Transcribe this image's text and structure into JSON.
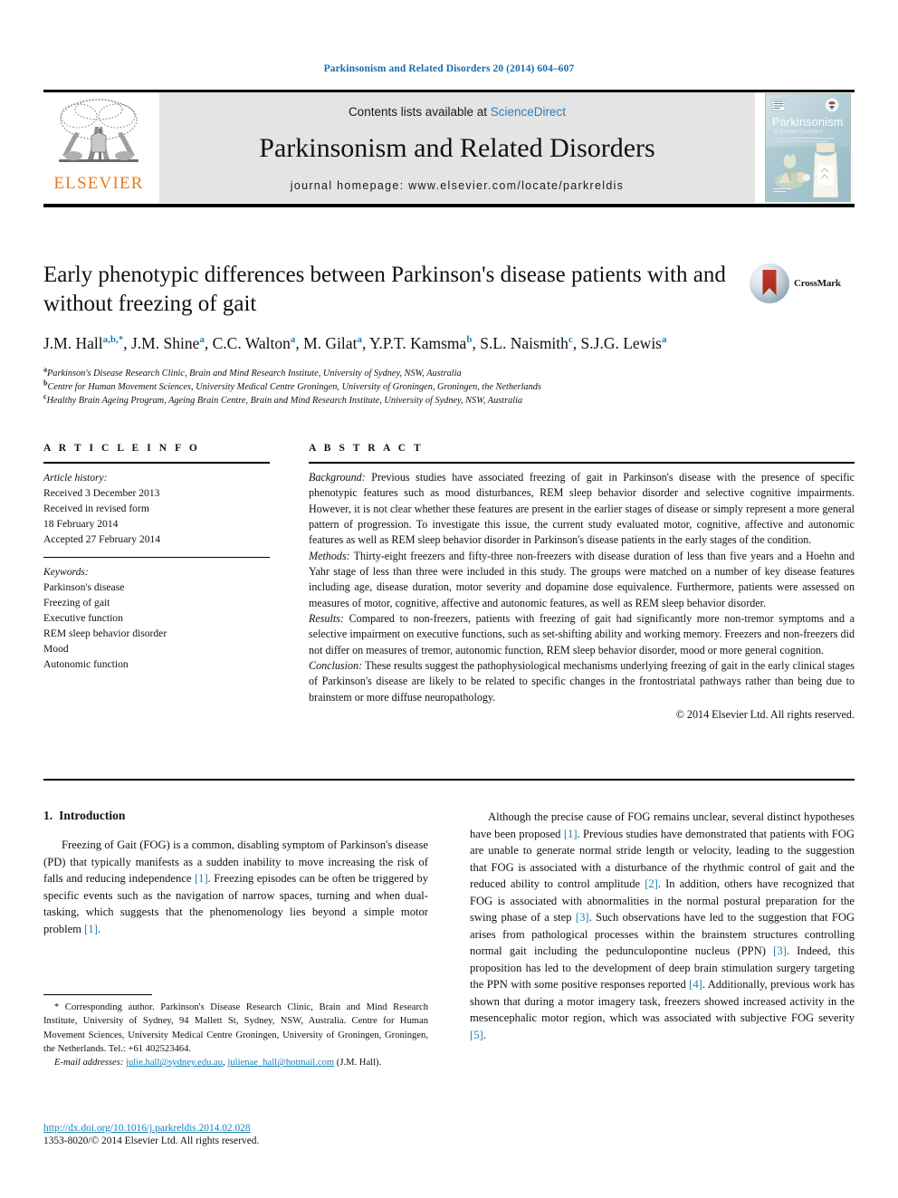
{
  "running_head": "Parkinsonism and Related Disorders 20 (2014) 604–607",
  "masthead": {
    "publisher_wordmark": "ELSEVIER",
    "contents_prefix": "Contents lists available at ",
    "contents_link": "ScienceDirect",
    "journal_title": "Parkinsonism and Related Disorders",
    "homepage": "journal homepage: www.elsevier.com/locate/parkreldis",
    "cover_title": "Parkinsonism",
    "cover_subtitle": "& Related Disorders"
  },
  "article": {
    "title": "Early phenotypic differences between Parkinson's disease patients with and without freezing of gait",
    "crossmark_label": "CrossMark",
    "authors_html": "J.M. Hall<sup>a,b,*</sup>, J.M. Shine<sup>a</sup>, C.C. Walton<sup>a</sup>, M. Gilat<sup>a</sup>, Y.P.T. Kamsma<sup>b</sup>, S.L. Naismith<sup>c</sup>, S.J.G. Lewis<sup>a</sup>",
    "affiliations": [
      {
        "marker": "a",
        "text": "Parkinson's Disease Research Clinic, Brain and Mind Research Institute, University of Sydney, NSW, Australia"
      },
      {
        "marker": "b",
        "text": "Centre for Human Movement Sciences, University Medical Centre Groningen, University of Groningen, Groningen, the Netherlands"
      },
      {
        "marker": "c",
        "text": "Healthy Brain Ageing Program, Ageing Brain Centre, Brain and Mind Research Institute, University of Sydney, NSW, Australia"
      }
    ]
  },
  "article_info": {
    "heading": "A R T I C L E  I N F O",
    "history_label": "Article history:",
    "history_lines": [
      "Received 3 December 2013",
      "Received in revised form",
      "18 February 2014",
      "Accepted 27 February 2014"
    ],
    "keywords_label": "Keywords:",
    "keywords": [
      "Parkinson's disease",
      "Freezing of gait",
      "Executive function",
      "REM sleep behavior disorder",
      "Mood",
      "Autonomic function"
    ]
  },
  "abstract": {
    "heading": "A B S T R A C T",
    "background_label": "Background:",
    "background_text": " Previous studies have associated freezing of gait in Parkinson's disease with the presence of specific phenotypic features such as mood disturbances, REM sleep behavior disorder and selective cognitive impairments. However, it is not clear whether these features are present in the earlier stages of disease or simply represent a more general pattern of progression. To investigate this issue, the current study evaluated motor, cognitive, affective and autonomic features as well as REM sleep behavior disorder in Parkinson's disease patients in the early stages of the condition.",
    "methods_label": "Methods:",
    "methods_text": " Thirty-eight freezers and fifty-three non-freezers with disease duration of less than five years and a Hoehn and Yahr stage of less than three were included in this study. The groups were matched on a number of key disease features including age, disease duration, motor severity and dopamine dose equivalence. Furthermore, patients were assessed on measures of motor, cognitive, affective and autonomic features, as well as REM sleep behavior disorder.",
    "results_label": "Results:",
    "results_text": " Compared to non-freezers, patients with freezing of gait had significantly more non-tremor symptoms and a selective impairment on executive functions, such as set-shifting ability and working memory. Freezers and non-freezers did not differ on measures of tremor, autonomic function, REM sleep behavior disorder, mood or more general cognition.",
    "conclusion_label": "Conclusion:",
    "conclusion_text": " These results suggest the pathophysiological mechanisms underlying freezing of gait in the early clinical stages of Parkinson's disease are likely to be related to specific changes in the frontostriatal pathways rather than being due to brainstem or more diffuse neuropathology.",
    "copyright": "© 2014 Elsevier Ltd. All rights reserved."
  },
  "introduction": {
    "number": "1.",
    "heading": "Introduction",
    "left_paragraph_html": "Freezing of Gait (FOG) is a common, disabling symptom of Parkinson's disease (PD) that typically manifests as a sudden inability to move increasing the risk of falls and reducing independence <span class=\"ref\">[1]</span>. Freezing episodes can be often be triggered by specific events such as the navigation of narrow spaces, turning and when dual-tasking, which suggests that the phenomenology lies beyond a simple motor problem <span class=\"ref\">[1]</span>.",
    "right_paragraph_html": "Although the precise cause of FOG remains unclear, several distinct hypotheses have been proposed <span class=\"ref\">[1]</span>. Previous studies have demonstrated that patients with FOG are unable to generate normal stride length or velocity, leading to the suggestion that FOG is associated with a disturbance of the rhythmic control of gait and the reduced ability to control amplitude <span class=\"ref\">[2]</span>. In addition, others have recognized that FOG is associated with abnormalities in the normal postural preparation for the swing phase of a step <span class=\"ref\">[3]</span>. Such observations have led to the suggestion that FOG arises from pathological processes within the brainstem structures controlling normal gait including the pedunculopontine nucleus (PPN) <span class=\"ref\">[3]</span>. Indeed, this proposition has led to the development of deep brain stimulation surgery targeting the PPN with some positive responses reported <span class=\"ref\">[4]</span>. Additionally, previous work has shown that during a motor imagery task, freezers showed increased activity in the mesencephalic motor region, which was associated with subjective FOG severity <span class=\"ref\">[5]</span>."
  },
  "footnote": {
    "corresponding_html": "* Corresponding author. Parkinson's Disease Research Clinic, Brain and Mind Research Institute, University of Sydney, 94 Mallett St, Sydney, NSW, Australia. Centre for Human Movement Sciences, University Medical Centre Groningen, University of Groningen, Groningen, the Netherlands. Tel.: +61 402523464.",
    "email_label": "E-mail addresses:",
    "email_1": "julie.hall@sydney.edu.au",
    "email_2": "julienae_hall@hotmail.com",
    "email_suffix": "(J.M. Hall).",
    "doi": "http://dx.doi.org/10.1016/j.parkreldis.2014.02.028",
    "issn_line": "1353-8020/© 2014 Elsevier Ltd. All rights reserved."
  },
  "colors": {
    "link_blue": "#1b7fb5",
    "elsevier_orange": "#e77b22",
    "panel_gray": "#e4e4e4"
  }
}
